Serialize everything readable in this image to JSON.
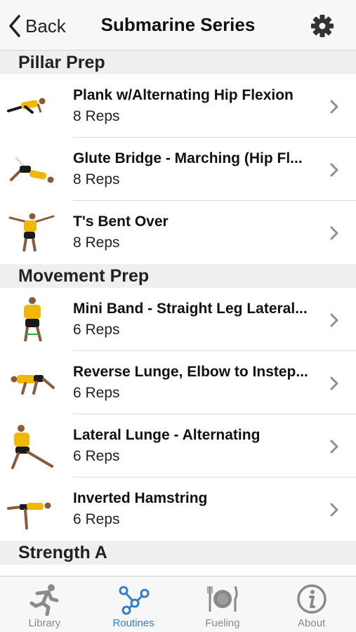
{
  "nav": {
    "back_label": "Back",
    "title": "Submarine Series"
  },
  "sections": [
    {
      "title": "Pillar Prep",
      "items": [
        {
          "title": "Plank w/Alternating Hip Flexion",
          "reps": "8 Reps"
        },
        {
          "title": "Glute Bridge - Marching (Hip Fl...",
          "reps": "8 Reps"
        },
        {
          "title": "T's Bent Over",
          "reps": "8 Reps"
        }
      ]
    },
    {
      "title": "Movement Prep",
      "items": [
        {
          "title": "Mini Band - Straight Leg Lateral...",
          "reps": "6 Reps"
        },
        {
          "title": "Reverse Lunge, Elbow to Instep...",
          "reps": "6 Reps"
        },
        {
          "title": "Lateral Lunge - Alternating",
          "reps": "6 Reps"
        },
        {
          "title": "Inverted Hamstring",
          "reps": "6 Reps"
        }
      ]
    },
    {
      "title": "Strength A",
      "items": []
    }
  ],
  "tabs": [
    {
      "label": "Library",
      "icon": "running-figure-icon"
    },
    {
      "label": "Routines",
      "icon": "routine-nodes-icon",
      "active": true
    },
    {
      "label": "Fueling",
      "icon": "plate-fork-knife-icon"
    },
    {
      "label": "About",
      "icon": "info-icon"
    }
  ],
  "colors": {
    "accent": "#2f7fd1",
    "shirt": "#f2b705",
    "shorts": "#1a1a1a",
    "chevron": "#8e8e93"
  }
}
